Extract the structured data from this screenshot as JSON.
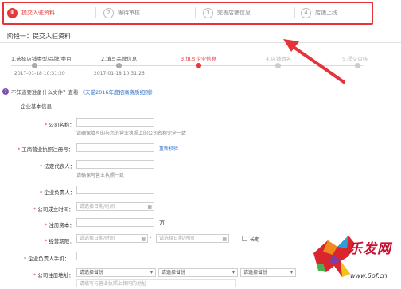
{
  "phases": [
    {
      "num": "1",
      "label": "提交入驻资料",
      "active": true
    },
    {
      "num": "2",
      "label": "等待审核"
    },
    {
      "num": "3",
      "label": "完善店铺信息"
    },
    {
      "num": "4",
      "label": "店铺上线"
    }
  ],
  "stage_title": "阶段一：提交入驻资料",
  "steps": [
    {
      "label": "1.选择店铺类型/品牌/类目",
      "time": "2017-01-18 10:31:20",
      "state": "done"
    },
    {
      "label": "2.填写品牌信息",
      "time": "2017-01-18 10:31:26",
      "state": "done"
    },
    {
      "label": "3.填写企业信息",
      "time": "",
      "state": "active"
    },
    {
      "label": "4.店铺命名",
      "time": "",
      "state": "pending"
    },
    {
      "label": "5.提交审核",
      "time": "",
      "state": "pending"
    }
  ],
  "notice": {
    "text": "不知道要准备什么文件？查看",
    "link": "《天猫2016年度招商资质细则》"
  },
  "section_title": "企业基本信息",
  "form": {
    "company_name": {
      "label": "公司名称：",
      "hint": "请确保填写的与您的营业执照上的公司名称完全一致"
    },
    "license_no": {
      "label": "工商营业执照注册号：",
      "link": "重新校验"
    },
    "legal_rep": {
      "label": "法定代表人：",
      "hint": "请确保与营业执照一致"
    },
    "principal": {
      "label": "企业负责人："
    },
    "founded": {
      "label": "公司成立时间：",
      "placeholder": "请选择日期/时间"
    },
    "capital": {
      "label": "注册资本：",
      "unit": "万"
    },
    "term": {
      "label": "经营期限：",
      "from_placeholder": "请选择日期/时间",
      "to_placeholder": "请选择日期/时间",
      "dash": "-",
      "long_term": "长期"
    },
    "principal_phone": {
      "label": "企业负责人手机："
    },
    "address": {
      "label": "公司注册地址：",
      "province": "请选择省份",
      "city": "请选择省份",
      "district": "请选择省份",
      "placeholder": "请填写与营业执照上相同的地址"
    }
  },
  "logo": {
    "text": "乐发网",
    "url": "www.6pf.cn"
  },
  "colors": {
    "accent": "#e4393c",
    "highlight": "#e5333a",
    "link": "#2f6fc2"
  }
}
